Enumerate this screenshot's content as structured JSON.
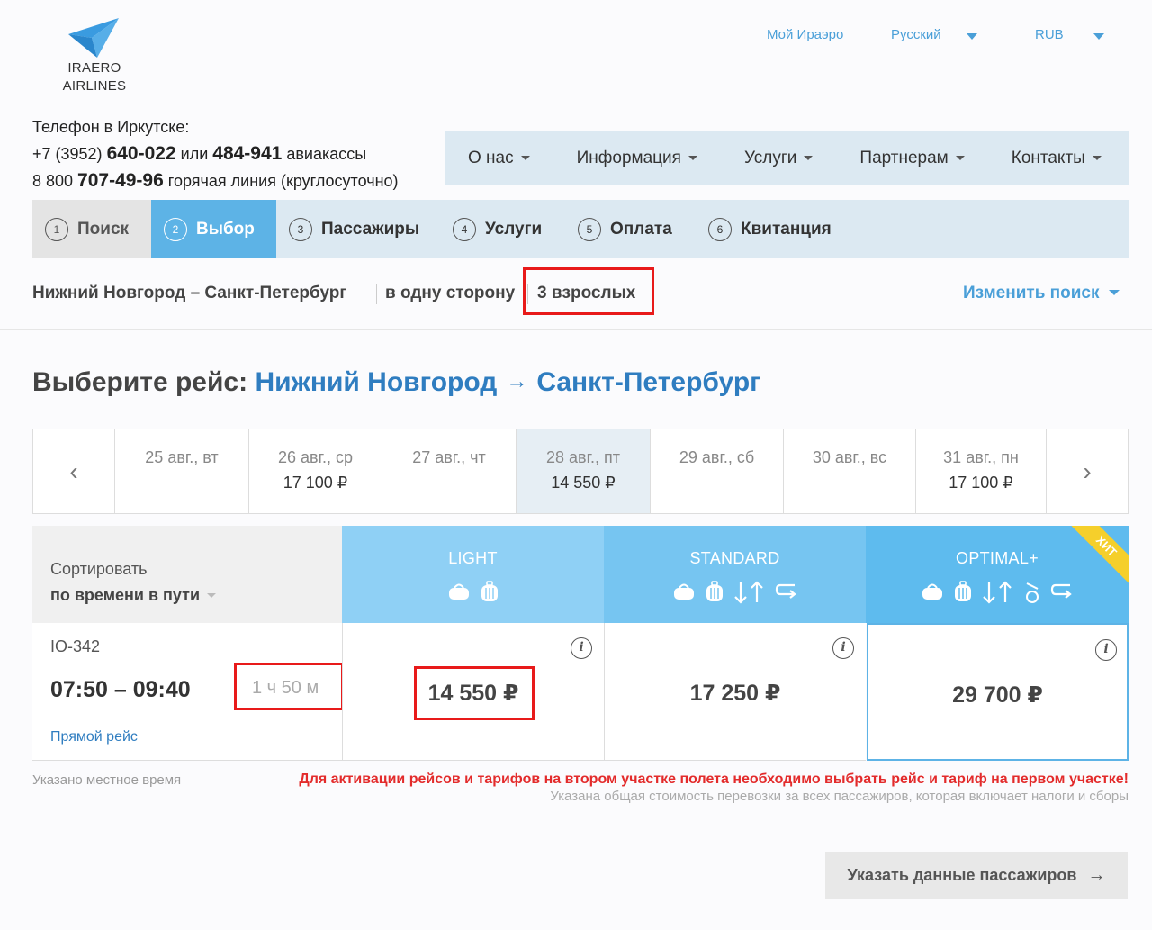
{
  "logo": {
    "line1": "IRAERO",
    "line2": "AIRLINES"
  },
  "top_links": {
    "account": "Мой Ираэро",
    "language": "Русский",
    "currency": "RUB"
  },
  "contacts": {
    "label": "Телефон в Иркутске:",
    "line2_prefix": "+7 (3952) ",
    "line2_num1": "640-022",
    "line2_mid": " или ",
    "line2_num2": "484-941",
    "line2_suffix": " авиакассы",
    "line3_prefix": "8 800 ",
    "line3_num": "707-49-96",
    "line3_suffix": " горячая линия (круглосуточно)"
  },
  "nav": [
    "О нас",
    "Информация",
    "Услуги",
    "Партнерам",
    "Контакты"
  ],
  "steps": [
    {
      "num": "1",
      "label": "Поиск"
    },
    {
      "num": "2",
      "label": "Выбор"
    },
    {
      "num": "3",
      "label": "Пассажиры"
    },
    {
      "num": "4",
      "label": "Услуги"
    },
    {
      "num": "5",
      "label": "Оплата"
    },
    {
      "num": "6",
      "label": "Квитанция"
    }
  ],
  "summary": {
    "route": "Нижний Новгород – Санкт-Петербург",
    "trip": "в одну сторону",
    "pax": "3 взрослых",
    "change": "Изменить поиск"
  },
  "choose": {
    "prefix": "Выберите рейс: ",
    "from": "Нижний Новгород",
    "arrow": "→",
    "to": "Санкт-Петербург"
  },
  "dates": [
    {
      "date": "25 авг., вт",
      "price": ""
    },
    {
      "date": "26 авг., ср",
      "price": "17 100 ₽"
    },
    {
      "date": "27 авг., чт",
      "price": ""
    },
    {
      "date": "28 авг., пт",
      "price": "14 550 ₽"
    },
    {
      "date": "29 авг., сб",
      "price": ""
    },
    {
      "date": "30 авг., вс",
      "price": ""
    },
    {
      "date": "31 авг., пн",
      "price": "17 100 ₽"
    }
  ],
  "date_nav": {
    "prev": "‹",
    "next": "›"
  },
  "sort": {
    "label": "Сортировать",
    "value": "по времени в пути"
  },
  "tariffs": [
    {
      "name": "LIGHT",
      "color": "#8fd0f5"
    },
    {
      "name": "STANDARD",
      "color": "#76c5f1"
    },
    {
      "name": "OPTIMAL+",
      "color": "#5ebbee",
      "badge": "ХИТ"
    }
  ],
  "flight": {
    "number": "IO-342",
    "times": "07:50 – 09:40",
    "duration": "1 ч 50 м",
    "direct": "Прямой рейс",
    "prices": [
      "14 550 ₽",
      "17 250 ₽",
      "29 700 ₽"
    ],
    "info": "i"
  },
  "notes": {
    "local_time": "Указано местное время",
    "warning": "Для активации рейсов и тарифов на втором участке полета необходимо выбрать рейс и тариф на первом участке!",
    "total": "Указана общая стоимость перевозки за всех пассажиров, которая включает налоги и сборы"
  },
  "next_button": {
    "label": "Указать данные пассажиров",
    "arrow": "→"
  },
  "colors": {
    "accent": "#4a9fd8",
    "step_active": "#5db3e6",
    "highlight": "#e81a1a",
    "title_blue": "#2f7dc0"
  }
}
